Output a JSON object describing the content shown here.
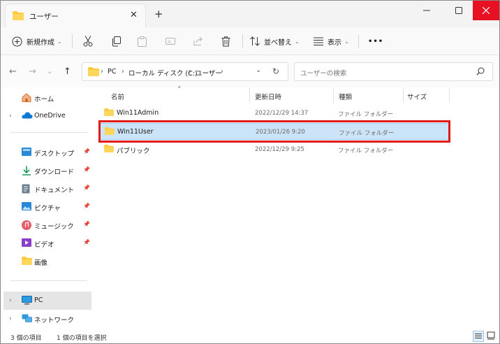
{
  "tab": {
    "title": "ユーザー"
  },
  "toolbar": {
    "new_label": "新規作成",
    "sort_label": "並べ替え",
    "view_label": "表示",
    "more_label": "•••"
  },
  "address": {
    "segments": [
      "PC",
      "ローカル ディスク (C:)",
      "ユーザー"
    ],
    "search_placeholder": "ユーザーの検索"
  },
  "sidebar": {
    "items": [
      {
        "label": "ホーム",
        "icon": "home-icon"
      },
      {
        "label": "OneDrive",
        "icon": "onedrive-icon"
      },
      {
        "label": "デスクトップ",
        "icon": "desktop-icon"
      },
      {
        "label": "ダウンロード",
        "icon": "download-icon"
      },
      {
        "label": "ドキュメント",
        "icon": "documents-icon"
      },
      {
        "label": "ピクチャ",
        "icon": "pictures-icon"
      },
      {
        "label": "ミュージック",
        "icon": "music-icon"
      },
      {
        "label": "ビデオ",
        "icon": "videos-icon"
      },
      {
        "label": "画像",
        "icon": "folder-icon"
      },
      {
        "label": "PC",
        "icon": "pc-icon"
      },
      {
        "label": "ネットワーク",
        "icon": "network-icon"
      }
    ]
  },
  "columns": {
    "name": "名前",
    "date": "更新日時",
    "type": "種類",
    "size": "サイズ"
  },
  "files": [
    {
      "name": "Win11Admin",
      "date": "2022/12/29 14:37",
      "type": "ファイル フォルダー"
    },
    {
      "name": "Win11User",
      "date": "2023/01/26 9:20",
      "type": "ファイル フォルダー"
    },
    {
      "name": "パブリック",
      "date": "2022/12/29 9:25",
      "type": "ファイル フォルダー"
    }
  ],
  "status": {
    "count": "3 個の項目",
    "selected": "1 個の項目を選択"
  },
  "colors": {
    "accent": "#0067c0",
    "selection": "#cce4f7",
    "highlight_box": "#e01919",
    "folder": "#ffc83d"
  }
}
